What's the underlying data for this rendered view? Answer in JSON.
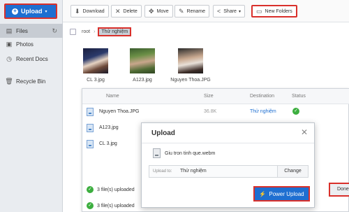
{
  "sidebar": {
    "upload_label": "Upload",
    "items": [
      {
        "label": "Files",
        "icon": "files-icon"
      },
      {
        "label": "Photos",
        "icon": "photos-icon"
      },
      {
        "label": "Recent Docs",
        "icon": "clock-icon"
      },
      {
        "label": "Recycle Bin",
        "icon": "trash-icon"
      }
    ]
  },
  "toolbar": {
    "download": "Download",
    "delete": "Delete",
    "move": "Move",
    "rename": "Rename",
    "share": "Share",
    "new_folders": "New Folders"
  },
  "breadcrumb": {
    "root": "root",
    "current": "Thử nghiệm"
  },
  "thumbnails": [
    {
      "label": "CL 3.jpg"
    },
    {
      "label": "A123.jpg"
    },
    {
      "label": "Nguyen Thoa.JPG"
    }
  ],
  "table": {
    "headers": {
      "name": "Name",
      "size": "Size",
      "destination": "Destination",
      "status": "Status"
    },
    "rows": [
      {
        "name": "Nguyen Thoa.JPG",
        "size": "36.8K",
        "destination": "Thử nghiệm",
        "status": "done"
      },
      {
        "name": "A123.jpg",
        "size": "",
        "destination": "",
        "status": ""
      },
      {
        "name": "CL 3.jpg",
        "size": "",
        "destination": "",
        "status": ""
      }
    ],
    "status_lines": [
      "3 file(s) uploaded",
      "3 file(s) uploaded"
    ],
    "done_label": "Done"
  },
  "dialog": {
    "title": "Upload",
    "file_name": "Giu tron tinh que.webm",
    "upload_to_label": "Upload to:",
    "upload_to_value": "Thử nghiệm",
    "change_label": "Change",
    "power_upload_label": "Power Upload"
  },
  "colors": {
    "accent": "#1e6fd1",
    "highlight_border": "#d9302b",
    "success": "#3cae3f"
  }
}
